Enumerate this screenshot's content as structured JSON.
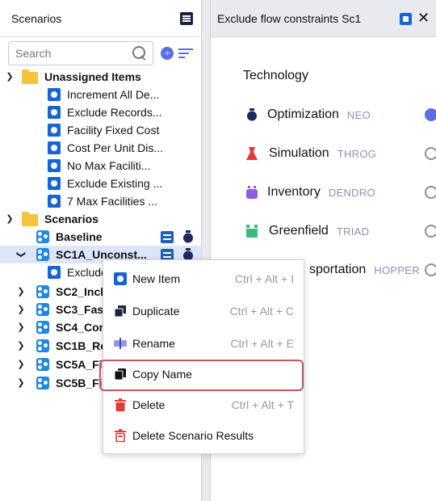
{
  "left_panel": {
    "title": "Scenarios",
    "search": {
      "placeholder": "Search",
      "value": ""
    },
    "sort_glyph": "÷",
    "tree": [
      {
        "kind": "folder",
        "label": "Unassigned Items",
        "expanded": true
      },
      {
        "kind": "item",
        "label": "Increment All De..."
      },
      {
        "kind": "item",
        "label": "Exclude Records..."
      },
      {
        "kind": "item",
        "label": "Facility Fixed Cost"
      },
      {
        "kind": "item",
        "label": "Cost Per Unit Dis..."
      },
      {
        "kind": "item",
        "label": "No Max Faciliti..."
      },
      {
        "kind": "item",
        "label": "Exclude Existing ..."
      },
      {
        "kind": "item",
        "label": "7 Max Facilities ..."
      },
      {
        "kind": "folder",
        "label": "Scenarios",
        "expanded": true
      },
      {
        "kind": "scenario",
        "label": "Baseline",
        "has_results": true,
        "tech": "NEO"
      },
      {
        "kind": "scenario",
        "label": "SC1A_Unconst...",
        "expanded": true,
        "selected": true,
        "has_results": true,
        "tech": "NEO"
      },
      {
        "kind": "item",
        "label": "Exclude"
      },
      {
        "kind": "scenario",
        "label": "SC2_Inclu",
        "expanded": false
      },
      {
        "kind": "scenario",
        "label": "SC3_Fast",
        "expanded": false
      },
      {
        "kind": "scenario",
        "label": "SC4_Cons",
        "expanded": false
      },
      {
        "kind": "scenario",
        "label": "SC1B_Re",
        "expanded": false
      },
      {
        "kind": "scenario",
        "label": "SC5A_Fix",
        "expanded": false
      },
      {
        "kind": "scenario",
        "label": "SC5B_Fix",
        "expanded": false
      }
    ]
  },
  "right_panel": {
    "tab_title": "Exclude flow constraints Sc1",
    "close_glyph": "✕",
    "heading": "Technology",
    "technologies": [
      {
        "name": "Optimization",
        "code": "NEO",
        "color": "#1c2a5e",
        "selected": true
      },
      {
        "name": "Simulation",
        "code": "THROG",
        "color": "#e53935",
        "selected": false
      },
      {
        "name": "Inventory",
        "code": "DENDRO",
        "color": "#8e5ce6",
        "selected": false
      },
      {
        "name": "Greenfield",
        "code": "TRIAD",
        "color": "#3dbb7a",
        "selected": false
      },
      {
        "name": "Transportation",
        "visible_name": "sportation",
        "code": "HOPPER",
        "color": "#2a7de1",
        "selected": false
      }
    ]
  },
  "context_menu": {
    "items": [
      {
        "label": "New Item",
        "shortcut": "Ctrl + Alt + I",
        "icon": "new-item-icon",
        "color": "#1565d8"
      },
      {
        "label": "Duplicate",
        "shortcut": "Ctrl + Alt + C",
        "icon": "duplicate-icon",
        "color": "#1c2340"
      },
      {
        "label": "Rename",
        "shortcut": "Ctrl + Alt + E",
        "icon": "rename-icon",
        "color": "#8e9ae8"
      },
      {
        "label": "Copy Name",
        "shortcut": "",
        "icon": "copy-icon",
        "color": "#111111",
        "highlighted": true
      },
      {
        "label": "Delete",
        "shortcut": "Ctrl + Alt + T",
        "icon": "trash-icon",
        "color": "#e53935"
      },
      {
        "label": "Delete Scenario Results",
        "shortcut": "",
        "icon": "trash-outline-icon",
        "color": "#e53935"
      }
    ]
  },
  "colors": {
    "accent": "#5a6ee6",
    "highlight_border": "#c8535a",
    "selection": "#dfe5f9"
  }
}
